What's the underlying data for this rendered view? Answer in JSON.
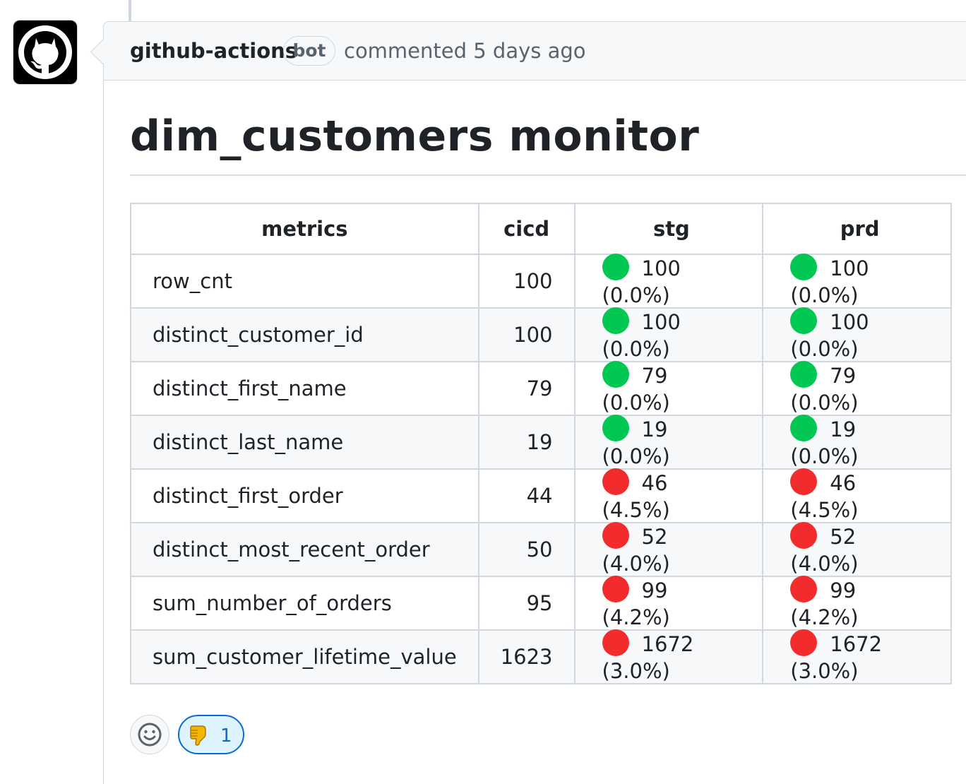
{
  "comment": {
    "author": "github-actions",
    "badge": "bot",
    "meta": "commented 5 days ago"
  },
  "report": {
    "title": "dim_customers monitor",
    "columns": [
      "metrics",
      "cicd",
      "stg",
      "prd"
    ],
    "rows": [
      {
        "metric": "row_cnt",
        "cicd": "100",
        "stg": "100 (0.0%)",
        "stg_status": "ok",
        "prd": "100 (0.0%)",
        "prd_status": "ok"
      },
      {
        "metric": "distinct_customer_id",
        "cicd": "100",
        "stg": "100 (0.0%)",
        "stg_status": "ok",
        "prd": "100 (0.0%)",
        "prd_status": "ok"
      },
      {
        "metric": "distinct_first_name",
        "cicd": "79",
        "stg": "79 (0.0%)",
        "stg_status": "ok",
        "prd": "79 (0.0%)",
        "prd_status": "ok"
      },
      {
        "metric": "distinct_last_name",
        "cicd": "19",
        "stg": "19 (0.0%)",
        "stg_status": "ok",
        "prd": "19 (0.0%)",
        "prd_status": "ok"
      },
      {
        "metric": "distinct_first_order",
        "cicd": "44",
        "stg": "46 (4.5%)",
        "stg_status": "alert",
        "prd": "46 (4.5%)",
        "prd_status": "alert"
      },
      {
        "metric": "distinct_most_recent_order",
        "cicd": "50",
        "stg": "52 (4.0%)",
        "stg_status": "alert",
        "prd": "52 (4.0%)",
        "prd_status": "alert"
      },
      {
        "metric": "sum_number_of_orders",
        "cicd": "95",
        "stg": "99 (4.2%)",
        "stg_status": "alert",
        "prd": "99 (4.2%)",
        "prd_status": "alert"
      },
      {
        "metric": "sum_customer_lifetime_value",
        "cicd": "1623",
        "stg": "1672 (3.0%)",
        "stg_status": "alert",
        "prd": "1672 (3.0%)",
        "prd_status": "alert"
      }
    ]
  },
  "status_colors": {
    "ok": "#00c853",
    "alert": "#f22c2c"
  },
  "reactions": {
    "add_icon": "smiley-icon",
    "thumbs_down_icon": "thumbs-down-icon",
    "thumbs_down_count": "1"
  }
}
